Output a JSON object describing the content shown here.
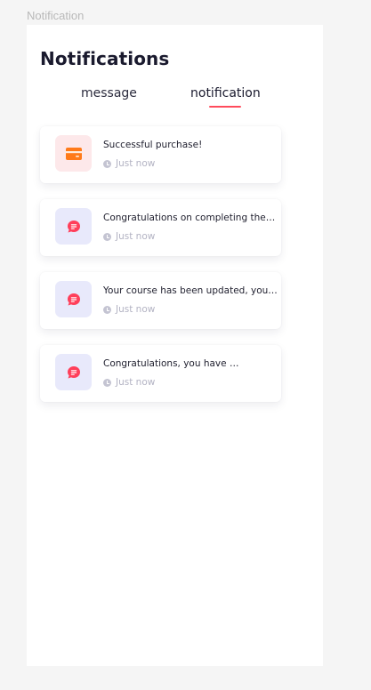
{
  "frame": {
    "label": "Notification"
  },
  "header": {
    "title": "Notifications"
  },
  "tabs": [
    {
      "label": "message",
      "active": false
    },
    {
      "label": "notification",
      "active": true
    }
  ],
  "colors": {
    "accent": "#ff4b5c",
    "purchase_bg": "#fde8ea",
    "purchase_icon": "#ff7a1a",
    "chat_bg": "#e8e9fb",
    "chat_icon": "#ff3f5a"
  },
  "notifications": [
    {
      "icon": "credit-card-icon",
      "text": "Successful purchase!",
      "time": "Just now"
    },
    {
      "icon": "chat-bubble-icon",
      "text": "Congratulations on completing the …",
      "time": "Just now"
    },
    {
      "icon": "chat-bubble-icon",
      "text": "Your course has been updated, you …",
      "time": "Just now"
    },
    {
      "icon": "chat-bubble-icon",
      "text": "Congratulations, you have …",
      "time": "Just now"
    }
  ]
}
